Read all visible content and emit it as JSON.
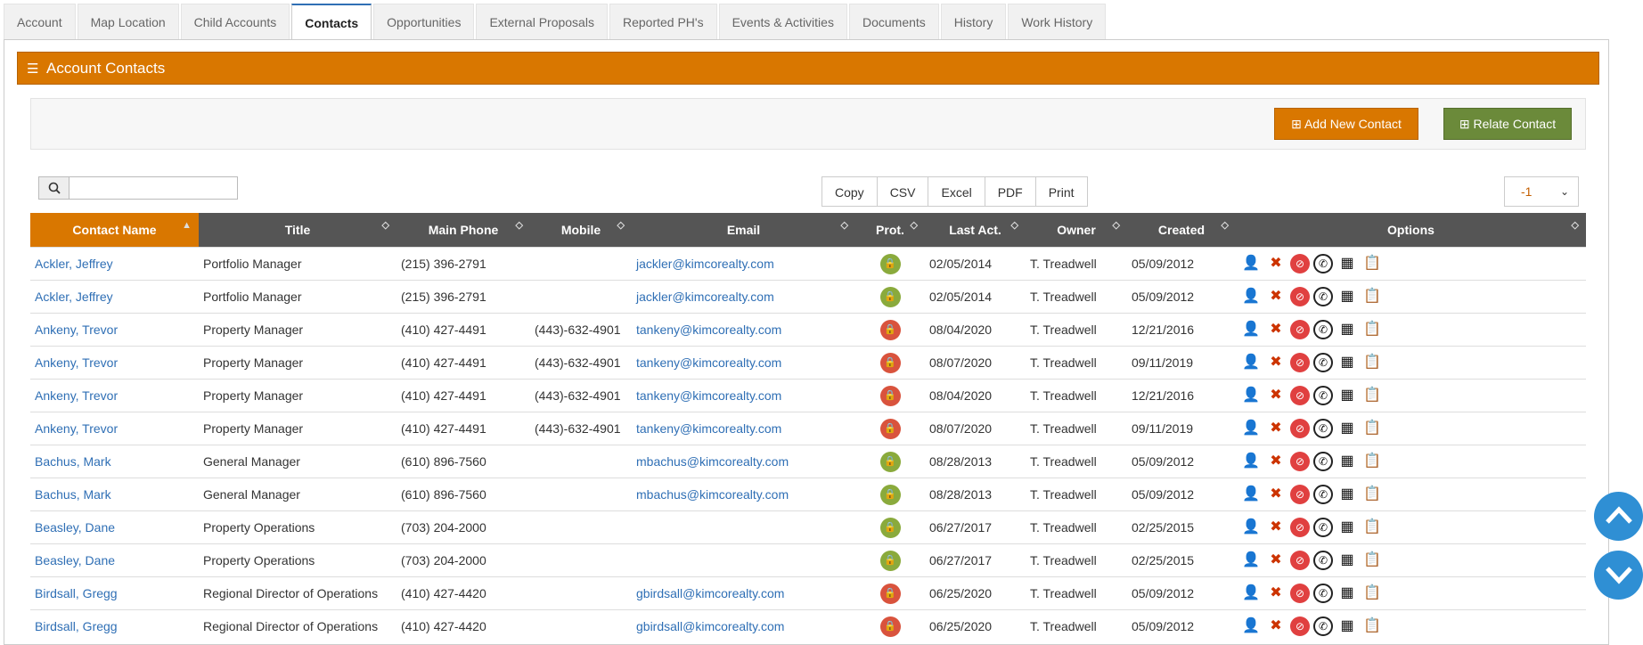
{
  "tabs": [
    {
      "label": "Account"
    },
    {
      "label": "Map Location"
    },
    {
      "label": "Child Accounts"
    },
    {
      "label": "Contacts",
      "active": true
    },
    {
      "label": "Opportunities"
    },
    {
      "label": "External Proposals"
    },
    {
      "label": "Reported PH's"
    },
    {
      "label": "Events & Activities"
    },
    {
      "label": "Documents"
    },
    {
      "label": "History"
    },
    {
      "label": "Work History"
    }
  ],
  "panel": {
    "title": "Account Contacts",
    "icon": "list-icon"
  },
  "toolbar": {
    "add_label": "⊞ Add New Contact",
    "relate_label": "⊞ Relate Contact"
  },
  "search": {
    "value": "",
    "placeholder": ""
  },
  "export": [
    "Copy",
    "CSV",
    "Excel",
    "PDF",
    "Print"
  ],
  "page_length": {
    "selected": "-1"
  },
  "columns": [
    "Contact Name",
    "Title",
    "Main Phone",
    "Mobile",
    "Email",
    "Prot.",
    "Last Act.",
    "Owner",
    "Created",
    "Options"
  ],
  "colors": {
    "accent": "#d97700",
    "relate": "#6b8a3a",
    "link": "#2f6fb5",
    "header": "#555555"
  },
  "rows": [
    {
      "name": "Ackler, Jeffrey",
      "title": "Portfolio Manager",
      "phone": "(215) 396-2791",
      "mobile": "",
      "email": "jackler@kimcorealty.com",
      "prot": "open",
      "last": "02/05/2014",
      "owner": "T. Treadwell",
      "created": "05/09/2012"
    },
    {
      "name": "Ackler, Jeffrey",
      "title": "Portfolio Manager",
      "phone": "(215) 396-2791",
      "mobile": "",
      "email": "jackler@kimcorealty.com",
      "prot": "open",
      "last": "02/05/2014",
      "owner": "T. Treadwell",
      "created": "05/09/2012"
    },
    {
      "name": "Ankeny, Trevor",
      "title": "Property Manager",
      "phone": "(410) 427-4491",
      "mobile": "(443)-632-4901",
      "email": "tankeny@kimcorealty.com",
      "prot": "closed",
      "last": "08/04/2020",
      "owner": "T. Treadwell",
      "created": "12/21/2016"
    },
    {
      "name": "Ankeny, Trevor",
      "title": "Property Manager",
      "phone": "(410) 427-4491",
      "mobile": "(443)-632-4901",
      "email": "tankeny@kimcorealty.com",
      "prot": "closed",
      "last": "08/07/2020",
      "owner": "T. Treadwell",
      "created": "09/11/2019"
    },
    {
      "name": "Ankeny, Trevor",
      "title": "Property Manager",
      "phone": "(410) 427-4491",
      "mobile": "(443)-632-4901",
      "email": "tankeny@kimcorealty.com",
      "prot": "closed",
      "last": "08/04/2020",
      "owner": "T. Treadwell",
      "created": "12/21/2016"
    },
    {
      "name": "Ankeny, Trevor",
      "title": "Property Manager",
      "phone": "(410) 427-4491",
      "mobile": "(443)-632-4901",
      "email": "tankeny@kimcorealty.com",
      "prot": "closed",
      "last": "08/07/2020",
      "owner": "T. Treadwell",
      "created": "09/11/2019"
    },
    {
      "name": "Bachus, Mark",
      "title": "General Manager",
      "phone": "(610) 896-7560",
      "mobile": "",
      "email": "mbachus@kimcorealty.com",
      "prot": "open",
      "last": "08/28/2013",
      "owner": "T. Treadwell",
      "created": "05/09/2012"
    },
    {
      "name": "Bachus, Mark",
      "title": "General Manager",
      "phone": "(610) 896-7560",
      "mobile": "",
      "email": "mbachus@kimcorealty.com",
      "prot": "open",
      "last": "08/28/2013",
      "owner": "T. Treadwell",
      "created": "05/09/2012"
    },
    {
      "name": "Beasley, Dane",
      "title": "Property Operations",
      "phone": "(703) 204-2000",
      "mobile": "",
      "email": "",
      "prot": "open",
      "last": "06/27/2017",
      "owner": "T. Treadwell",
      "created": "02/25/2015"
    },
    {
      "name": "Beasley, Dane",
      "title": "Property Operations",
      "phone": "(703) 204-2000",
      "mobile": "",
      "email": "",
      "prot": "open",
      "last": "06/27/2017",
      "owner": "T. Treadwell",
      "created": "02/25/2015"
    },
    {
      "name": "Birdsall, Gregg",
      "title": "Regional Director of Operations",
      "phone": "(410) 427-4420",
      "mobile": "",
      "email": "gbirdsall@kimcorealty.com",
      "prot": "closed",
      "last": "06/25/2020",
      "owner": "T. Treadwell",
      "created": "05/09/2012"
    },
    {
      "name": "Birdsall, Gregg",
      "title": "Regional Director of Operations",
      "phone": "(410) 427-4420",
      "mobile": "",
      "email": "gbirdsall@kimcorealty.com",
      "prot": "closed",
      "last": "06/25/2020",
      "owner": "T. Treadwell",
      "created": "05/09/2012"
    }
  ]
}
